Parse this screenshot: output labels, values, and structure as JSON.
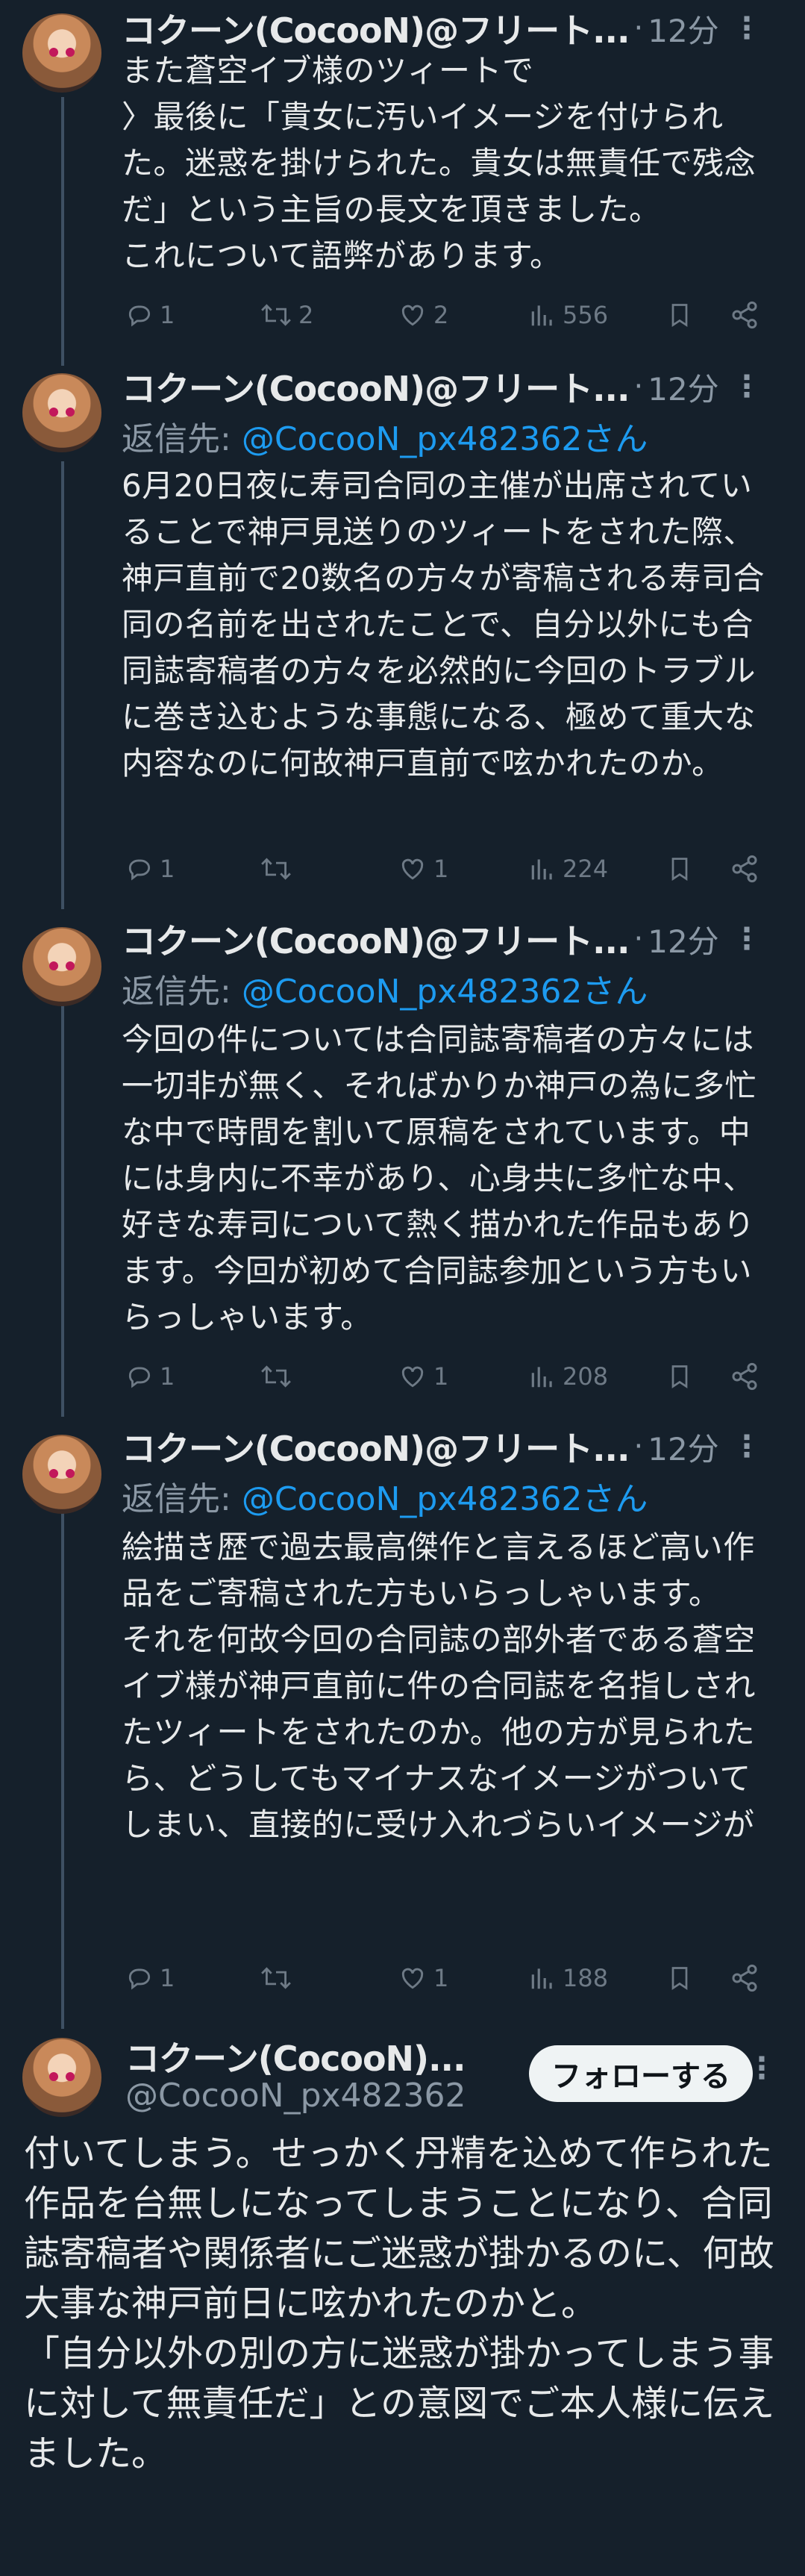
{
  "author": {
    "name_truncated": "コクーン(CocooN)@フリート...",
    "name_short": "コクーン(CocooN)...",
    "handle": "@CocooN_px482362"
  },
  "follow_label": "フォローする",
  "reply_prefix": "返信先: ",
  "reply_handle": "@CocooN_px482362さん",
  "tweets": [
    {
      "time": "12分",
      "body": "また蒼空イブ様のツィートで\n〉最後に「貴女に汚いイメージを付けられた。迷惑を掛けられた。貴女は無責任で残念だ」という主旨の長文を頂きました。\nこれについて語弊があります。",
      "replies": "1",
      "retweets": "2",
      "likes": "2",
      "views": "556"
    },
    {
      "time": "12分",
      "body": "6月20日夜に寿司合同の主催が出席されていることで神戸見送りのツィートをされた際、神戸直前で20数名の方々が寄稿される寿司合同の名前を出されたことで、自分以外にも合同誌寄稿者の方々を必然的に今回のトラブルに巻き込むような事態になる、極めて重大な内容なのに何故神戸直前で呟かれたのか。",
      "replies": "1",
      "retweets": "",
      "likes": "1",
      "views": "224"
    },
    {
      "time": "12分",
      "body": "今回の件については合同誌寄稿者の方々には一切非が無く、そればかりか神戸の為に多忙な中で時間を割いて原稿をされています。中には身内に不幸があり、心身共に多忙な中、好きな寿司について熱く描かれた作品もあります。今回が初めて合同誌参加という方もいらっしゃいます。",
      "replies": "1",
      "retweets": "",
      "likes": "1",
      "views": "208"
    },
    {
      "time": "12分",
      "body": "絵描き歴で過去最高傑作と言えるほど高い作品をご寄稿された方もいらっしゃいます。\nそれを何故今回の合同誌の部外者である蒼空イブ様が神戸直前に件の合同誌を名指しされたツィートをされたのか。他の方が見られたら、どうしてもマイナスなイメージがついてしまい、直接的に受け入れづらいイメージが",
      "replies": "1",
      "retweets": "",
      "likes": "1",
      "views": "188"
    }
  ],
  "main_tweet": {
    "body": "付いてしまう。せっかく丹精を込めて作られた作品を台無しになってしまうことになり、合同誌寄稿者や関係者にご迷惑が掛かるのに、何故大事な神戸前日に呟かれたのかと。\n「自分以外の別の方に迷惑が掛かってしまう事に対して無責任だ」との意図でご本人様に伝えました。"
  },
  "colors": {
    "background": "#15202b",
    "accent": "#1d9bf0",
    "muted": "#8b98a5"
  },
  "icons": [
    "reply-icon",
    "retweet-icon",
    "like-icon",
    "views-icon",
    "bookmark-icon",
    "share-icon",
    "more-icon"
  ]
}
